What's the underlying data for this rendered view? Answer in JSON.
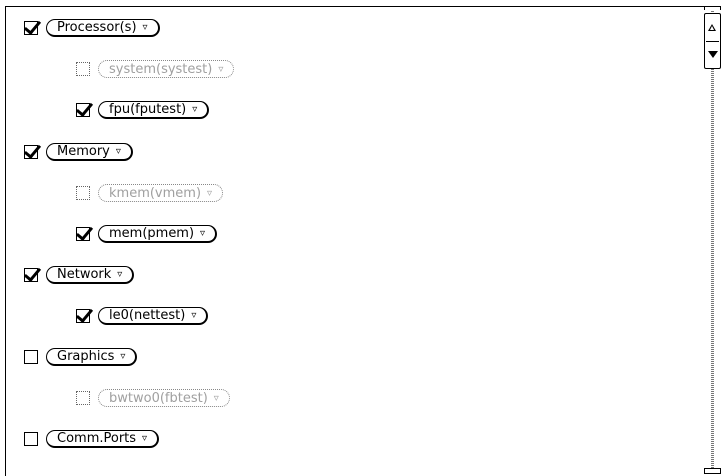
{
  "items": [
    {
      "label": "Processor(s)",
      "checked": true,
      "enabled": true,
      "level": 0
    },
    {
      "label": "system(systest)",
      "checked": false,
      "enabled": false,
      "level": 1
    },
    {
      "label": "fpu(fputest)",
      "checked": true,
      "enabled": true,
      "level": 1
    },
    {
      "label": "Memory",
      "checked": true,
      "enabled": true,
      "level": 0
    },
    {
      "label": "kmem(vmem)",
      "checked": false,
      "enabled": false,
      "level": 1
    },
    {
      "label": "mem(pmem)",
      "checked": true,
      "enabled": true,
      "level": 1
    },
    {
      "label": "Network",
      "checked": true,
      "enabled": true,
      "level": 0
    },
    {
      "label": "le0(nettest)",
      "checked": true,
      "enabled": true,
      "level": 1
    },
    {
      "label": "Graphics",
      "checked": false,
      "enabled": true,
      "level": 0
    },
    {
      "label": "bwtwo0(fbtest)",
      "checked": false,
      "enabled": false,
      "level": 1
    },
    {
      "label": "Comm.Ports",
      "checked": false,
      "enabled": true,
      "level": 0
    }
  ],
  "menu_glyph": "▿"
}
